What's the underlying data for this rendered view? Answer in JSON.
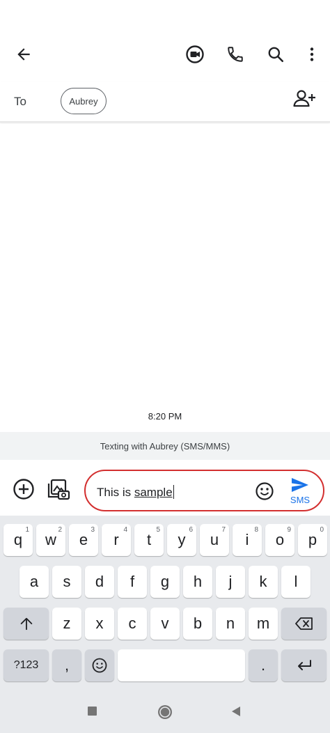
{
  "header": {
    "back_icon": "arrow-back-icon",
    "video_icon": "video-call-icon",
    "phone_icon": "phone-icon",
    "search_icon": "search-icon",
    "more_icon": "more-vert-icon"
  },
  "recipient_row": {
    "to_label": "To",
    "recipient_chip": "Aubrey",
    "add_icon": "add-person-icon"
  },
  "conversation": {
    "timestamp": "8:20 PM",
    "texting_notice": "Texting with Aubrey (SMS/MMS)"
  },
  "compose": {
    "text_before": "This is ",
    "text_underlined": "sample",
    "send_label": "SMS",
    "accent_color": "#1a73e8",
    "highlight_color": "#d32f2f"
  },
  "keyboard": {
    "row1": [
      {
        "key": "q",
        "hint": "1"
      },
      {
        "key": "w",
        "hint": "2"
      },
      {
        "key": "e",
        "hint": "3"
      },
      {
        "key": "r",
        "hint": "4"
      },
      {
        "key": "t",
        "hint": "5"
      },
      {
        "key": "y",
        "hint": "6"
      },
      {
        "key": "u",
        "hint": "7"
      },
      {
        "key": "i",
        "hint": "8"
      },
      {
        "key": "o",
        "hint": "9"
      },
      {
        "key": "p",
        "hint": "0"
      }
    ],
    "row2": [
      "a",
      "s",
      "d",
      "f",
      "g",
      "h",
      "j",
      "k",
      "l"
    ],
    "row3": [
      "z",
      "x",
      "c",
      "v",
      "b",
      "n",
      "m"
    ],
    "symbols_key": "?123",
    "comma_key": ",",
    "period_key": "."
  }
}
